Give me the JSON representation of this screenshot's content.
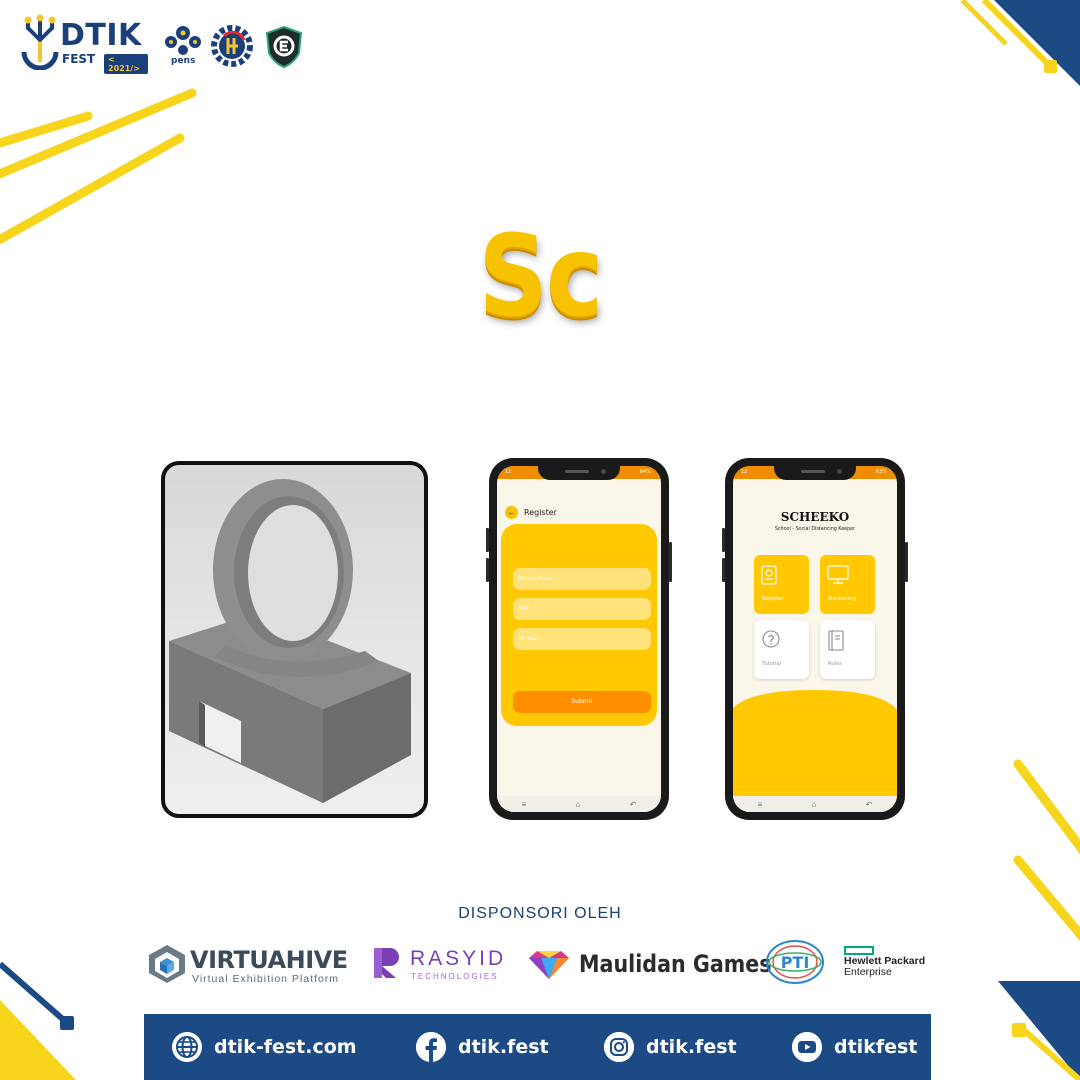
{
  "header": {
    "brand_name": "DTIK",
    "brand_sub": "FEST",
    "brand_year": "< 2021/>",
    "partner_text": "pens"
  },
  "title": "Sc",
  "register_screen": {
    "status_time": "12",
    "status_battery": "64%",
    "title": "Register",
    "field_1_placeholder": "Nama Siswa",
    "field_2_placeholder": "NRP",
    "field_3_placeholder": "ID Alat",
    "submit_label": "Submit"
  },
  "home_screen": {
    "status_time": "12",
    "status_battery": "63%",
    "app_name": "SCHEEKO",
    "app_tagline": "School - Social Distancing Keeper",
    "tiles": [
      {
        "label": "Register",
        "icon": "id-card-icon",
        "style": "yellow"
      },
      {
        "label": "Monitoring",
        "icon": "monitor-icon",
        "style": "yellow"
      },
      {
        "label": "Tutorial",
        "icon": "question-bubble-icon",
        "style": "white"
      },
      {
        "label": "Rules",
        "icon": "book-icon",
        "style": "white"
      }
    ]
  },
  "sponsors": {
    "heading": "DISPONSORI OLEH",
    "virtuahive": {
      "name": "VIRTUAHIVE",
      "tagline": "Virtual Exhibition Platform"
    },
    "rasyid": {
      "name": "RASYID",
      "tagline": "TECHNOLOGIES"
    },
    "maulidan": {
      "name": "Maulidan Games"
    },
    "pti": {
      "name": "PTI"
    },
    "hpe": {
      "line1": "Hewlett Packard",
      "line2": "Enterprise"
    }
  },
  "footer": {
    "website": "dtik-fest.com",
    "facebook": "dtik.fest",
    "instagram": "dtik.fest",
    "youtube": "dtikfest"
  },
  "colors": {
    "navy": "#1b4a85",
    "yellow": "#f7d51d",
    "app_yellow": "#ffc800",
    "app_orange": "#ff8f00"
  }
}
